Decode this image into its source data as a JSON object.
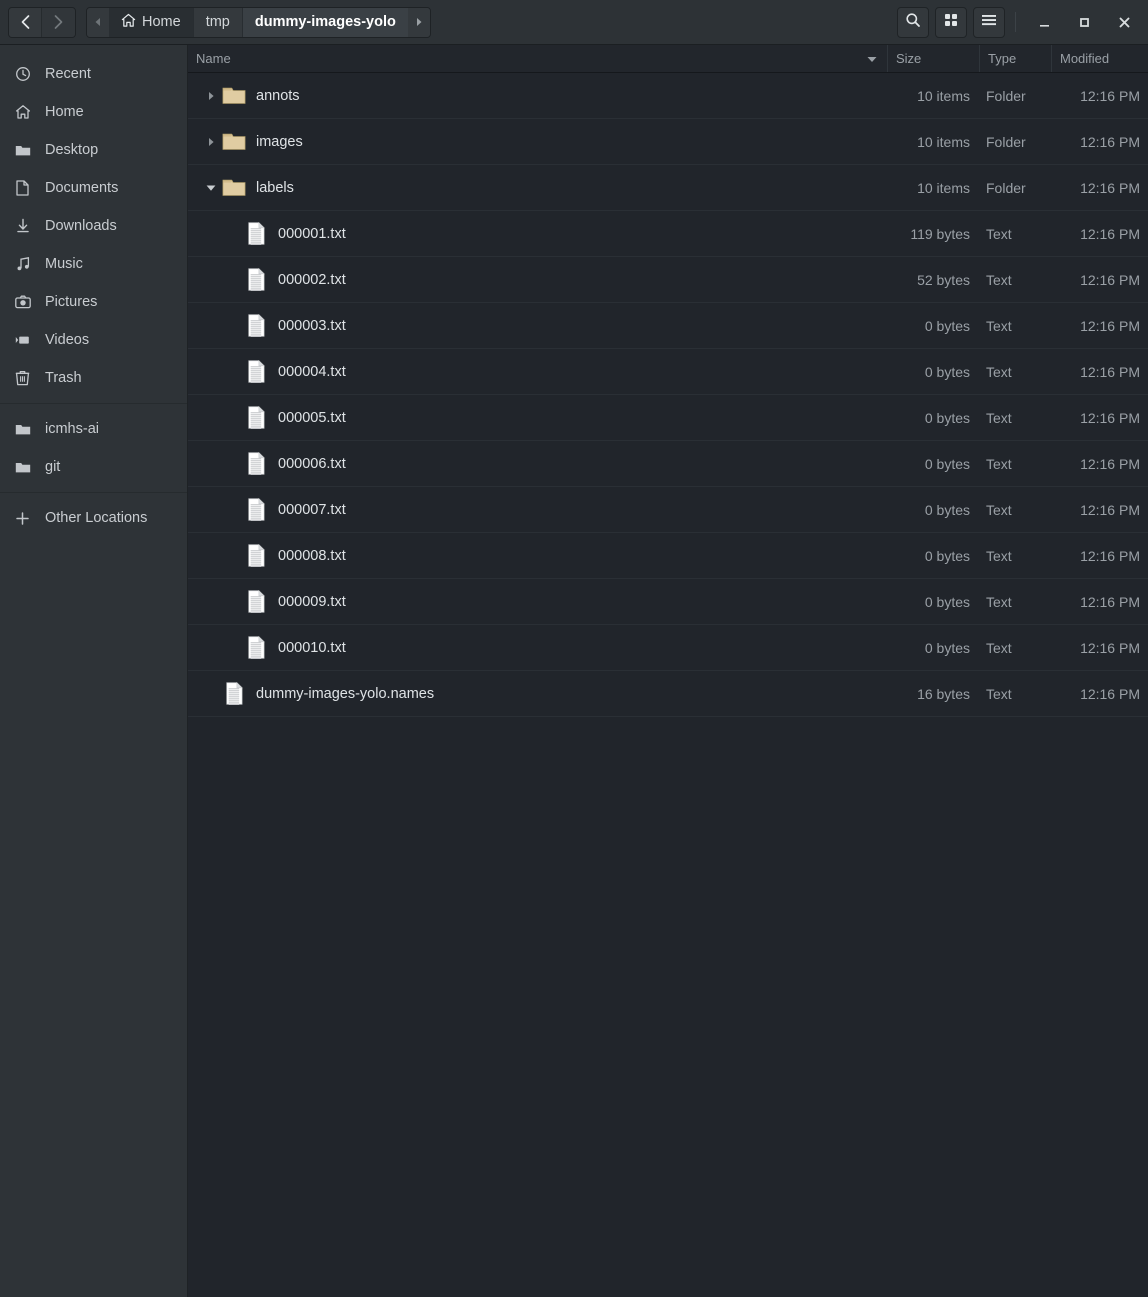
{
  "window": {
    "controls": {
      "minimize_label": "Minimize",
      "maximize_label": "Maximize",
      "close_label": "Close"
    }
  },
  "header": {
    "back_label": "Back",
    "forward_label": "Forward",
    "prev_crumb_label": "Previous path",
    "next_crumb_label": "Next path",
    "breadcrumbs": [
      {
        "label": "Home",
        "icon": "home-icon",
        "current": false
      },
      {
        "label": "tmp",
        "icon": "",
        "current": false
      },
      {
        "label": "dummy-images-yolo",
        "icon": "",
        "current": true
      }
    ],
    "buttons": [
      {
        "name": "search-button",
        "icon": "search-icon",
        "label": "Search"
      },
      {
        "name": "view-grid-button",
        "icon": "grid-view-icon",
        "label": "Grid view"
      },
      {
        "name": "main-menu-button",
        "icon": "hamburger-menu-icon",
        "label": "Menu"
      }
    ]
  },
  "sidebar": {
    "places": [
      {
        "label": "Recent",
        "icon": "clock-icon"
      },
      {
        "label": "Home",
        "icon": "home-icon"
      },
      {
        "label": "Desktop",
        "icon": "folder-icon"
      },
      {
        "label": "Documents",
        "icon": "document-icon"
      },
      {
        "label": "Downloads",
        "icon": "download-icon"
      },
      {
        "label": "Music",
        "icon": "music-note-icon"
      },
      {
        "label": "Pictures",
        "icon": "camera-icon"
      },
      {
        "label": "Videos",
        "icon": "camcorder-icon"
      },
      {
        "label": "Trash",
        "icon": "trash-icon"
      }
    ],
    "bookmarks": [
      {
        "label": "icmhs-ai",
        "icon": "folder-icon"
      },
      {
        "label": "git",
        "icon": "folder-icon"
      }
    ],
    "other": {
      "label": "Other Locations",
      "icon": "plus-icon"
    }
  },
  "filelist": {
    "columns": {
      "name": "Name",
      "size": "Size",
      "type": "Type",
      "modified": "Modified"
    },
    "sort_column": "Name",
    "sort_direction": "descending",
    "rows": [
      {
        "name": "annots",
        "size": "10 items",
        "type": "Folder",
        "modified": "12:16 PM",
        "kind": "folder",
        "expanded": false,
        "indent": 0
      },
      {
        "name": "images",
        "size": "10 items",
        "type": "Folder",
        "modified": "12:16 PM",
        "kind": "folder",
        "expanded": false,
        "indent": 0
      },
      {
        "name": "labels",
        "size": "10 items",
        "type": "Folder",
        "modified": "12:16 PM",
        "kind": "folder",
        "expanded": true,
        "indent": 0
      },
      {
        "name": "000001.txt",
        "size": "119 bytes",
        "type": "Text",
        "modified": "12:16 PM",
        "kind": "file",
        "indent": 1
      },
      {
        "name": "000002.txt",
        "size": "52 bytes",
        "type": "Text",
        "modified": "12:16 PM",
        "kind": "file",
        "indent": 1
      },
      {
        "name": "000003.txt",
        "size": "0 bytes",
        "type": "Text",
        "modified": "12:16 PM",
        "kind": "file",
        "indent": 1
      },
      {
        "name": "000004.txt",
        "size": "0 bytes",
        "type": "Text",
        "modified": "12:16 PM",
        "kind": "file",
        "indent": 1
      },
      {
        "name": "000005.txt",
        "size": "0 bytes",
        "type": "Text",
        "modified": "12:16 PM",
        "kind": "file",
        "indent": 1
      },
      {
        "name": "000006.txt",
        "size": "0 bytes",
        "type": "Text",
        "modified": "12:16 PM",
        "kind": "file",
        "indent": 1
      },
      {
        "name": "000007.txt",
        "size": "0 bytes",
        "type": "Text",
        "modified": "12:16 PM",
        "kind": "file",
        "indent": 1
      },
      {
        "name": "000008.txt",
        "size": "0 bytes",
        "type": "Text",
        "modified": "12:16 PM",
        "kind": "file",
        "indent": 1
      },
      {
        "name": "000009.txt",
        "size": "0 bytes",
        "type": "Text",
        "modified": "12:16 PM",
        "kind": "file",
        "indent": 1
      },
      {
        "name": "000010.txt",
        "size": "0 bytes",
        "type": "Text",
        "modified": "12:16 PM",
        "kind": "file",
        "indent": 1
      },
      {
        "name": "dummy-images-yolo.names",
        "size": "16 bytes",
        "type": "Text",
        "modified": "12:16 PM",
        "kind": "file",
        "indent": 0
      }
    ]
  },
  "colors": {
    "headerbar": "#2d3236",
    "sidebar": "#2e3337",
    "filepane": "#21252b",
    "folder_icon": "#e3cfa4",
    "text": "#dfe3e6",
    "muted_text": "#9aa0a6"
  }
}
